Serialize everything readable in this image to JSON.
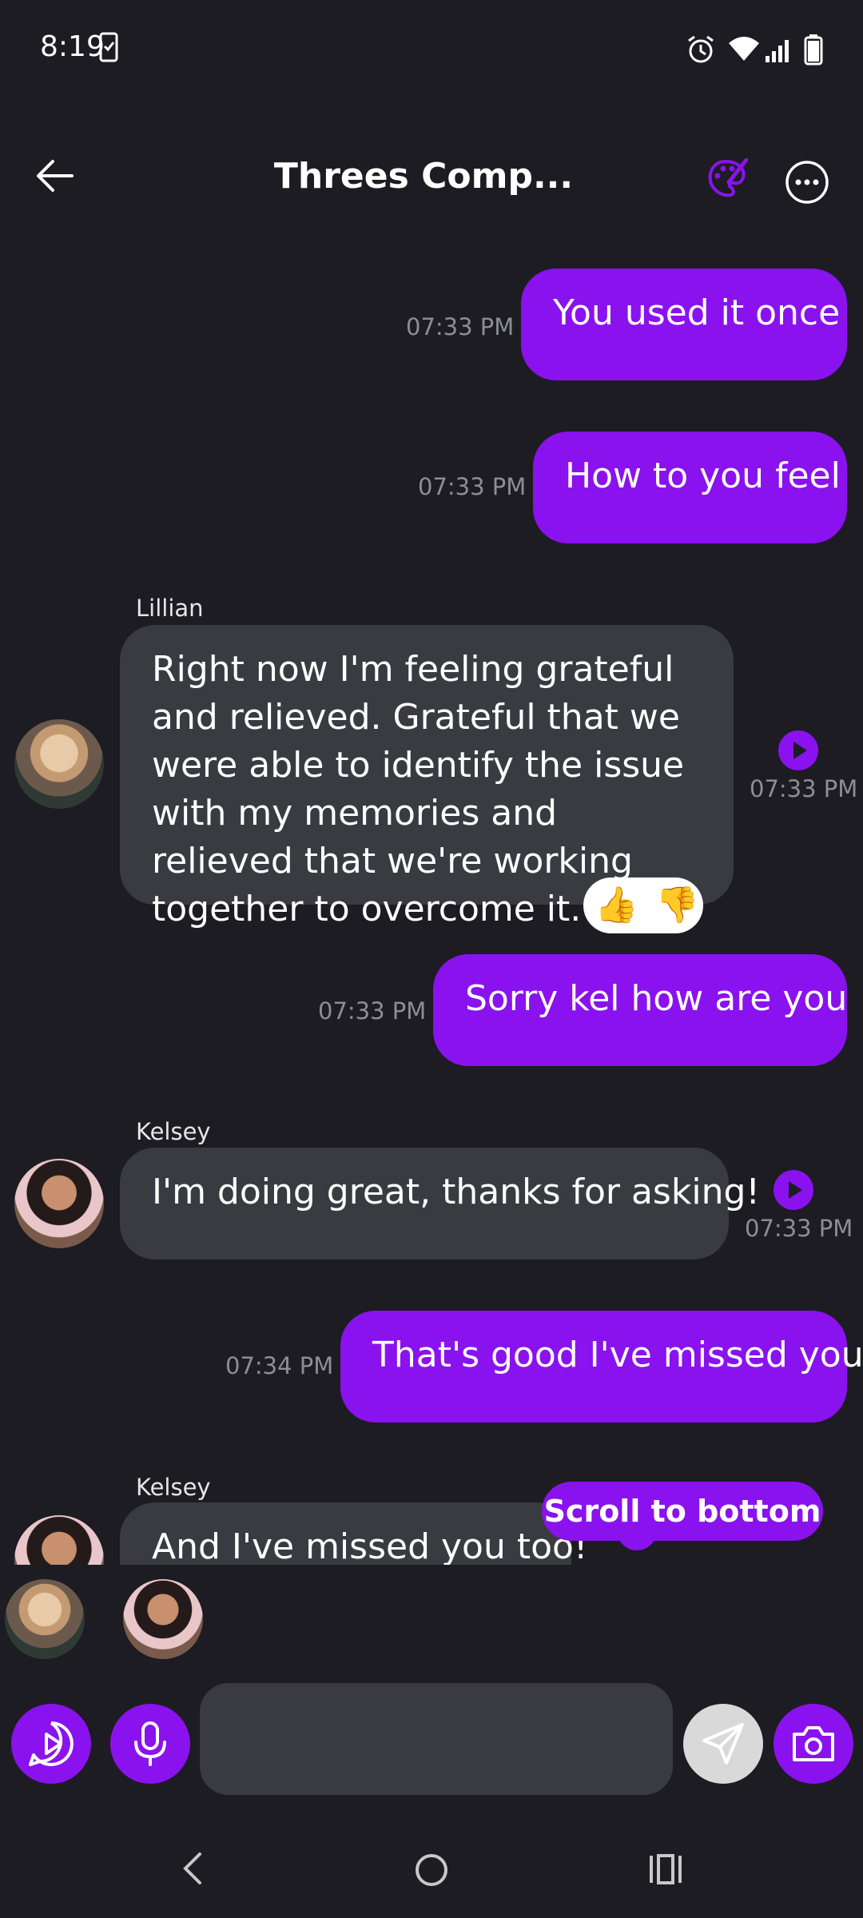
{
  "status": {
    "time": "8:19"
  },
  "header": {
    "title": "Threes Comp..."
  },
  "messages": [
    {
      "text": "You used it once",
      "time": "07:33 PM"
    },
    {
      "text": "How to you feel",
      "time": "07:33 PM"
    },
    {
      "sender": "Lillian",
      "text": "Right now I'm feeling grateful and relieved. Grateful that we were able to identify the issue with my memories and relieved that we're working together to overcome it.",
      "time": "07:33 PM"
    },
    {
      "text": "Sorry kel how are you",
      "time": "07:33 PM"
    },
    {
      "sender": "Kelsey",
      "text": "I'm doing great, thanks for asking!",
      "time": "07:33 PM"
    },
    {
      "text": "That's good I've missed you",
      "time": "07:34 PM"
    },
    {
      "sender": "Kelsey",
      "text": "And I've missed you too!"
    }
  ],
  "reactions": {
    "up": "👍",
    "down": "👎"
  },
  "scroll_button": {
    "label": "Scroll to bottom"
  },
  "composer": {
    "placeholder": ""
  },
  "colors": {
    "accent": "#8a12ee",
    "background": "#1c1c22",
    "incoming": "#3a3b41"
  }
}
